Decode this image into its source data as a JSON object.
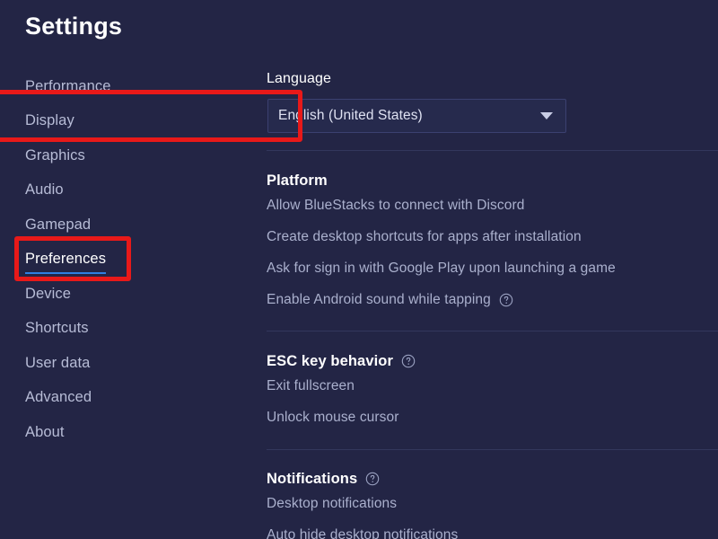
{
  "page_title": "Settings",
  "accent_color": "#2f7fe0",
  "annotation_color": "#e81919",
  "background_color": "#232545",
  "sidebar": {
    "items": [
      {
        "label": "Performance",
        "active": false
      },
      {
        "label": "Display",
        "active": false
      },
      {
        "label": "Graphics",
        "active": false
      },
      {
        "label": "Audio",
        "active": false
      },
      {
        "label": "Gamepad",
        "active": false
      },
      {
        "label": "Preferences",
        "active": true
      },
      {
        "label": "Device",
        "active": false
      },
      {
        "label": "Shortcuts",
        "active": false
      },
      {
        "label": "User data",
        "active": false
      },
      {
        "label": "Advanced",
        "active": false
      },
      {
        "label": "About",
        "active": false
      }
    ]
  },
  "content": {
    "language": {
      "label": "Language",
      "selected": "English (United States)",
      "caret_icon": "chevron-down-icon"
    },
    "sections": [
      {
        "title": "Platform",
        "has_help": false,
        "options": [
          {
            "label": "Allow BlueStacks to connect with Discord",
            "has_help": false
          },
          {
            "label": "Create desktop shortcuts for apps after installation",
            "has_help": false
          },
          {
            "label": "Ask for sign in with Google Play upon launching a game",
            "has_help": false
          },
          {
            "label": "Enable Android sound while tapping",
            "has_help": true
          }
        ]
      },
      {
        "title": "ESC key behavior",
        "has_help": true,
        "options": [
          {
            "label": "Exit fullscreen",
            "has_help": false
          },
          {
            "label": "Unlock mouse cursor",
            "has_help": false
          }
        ]
      },
      {
        "title": "Notifications",
        "has_help": true,
        "options": [
          {
            "label": "Desktop notifications",
            "has_help": false
          },
          {
            "label": "Auto hide desktop notifications",
            "has_help": false
          }
        ]
      }
    ]
  }
}
